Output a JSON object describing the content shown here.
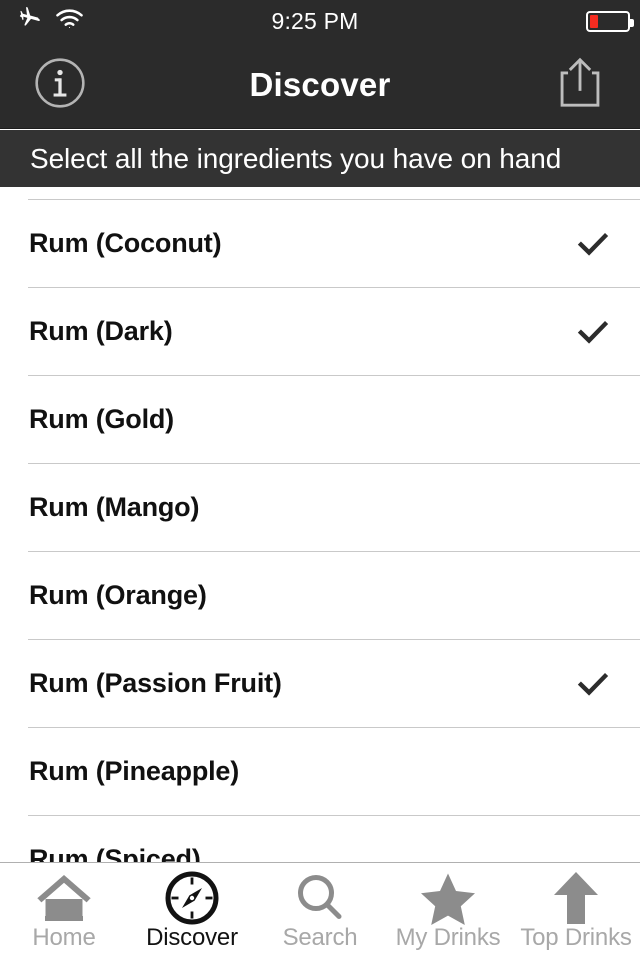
{
  "status_bar": {
    "airplane_icon": "airplane-icon",
    "wifi_icon": "wifi-icon",
    "time": "9:25 PM",
    "battery_icon": "battery-icon",
    "battery_level_percent": 22,
    "battery_color": "#f52c20"
  },
  "nav_bar": {
    "info_icon": "info-circle-icon",
    "title": "Discover",
    "share_icon": "share-icon",
    "background_color": "#2b2b2b"
  },
  "subtitle_bar": {
    "text": "Select all the ingredients you have on hand",
    "background_color": "#333333"
  },
  "list": {
    "check_icon": "checkmark-icon",
    "rows": [
      {
        "label": "Rum (Coconut)",
        "selected": true
      },
      {
        "label": "Rum (Dark)",
        "selected": true
      },
      {
        "label": "Rum (Gold)",
        "selected": false
      },
      {
        "label": "Rum (Mango)",
        "selected": false
      },
      {
        "label": "Rum (Orange)",
        "selected": false
      },
      {
        "label": "Rum (Passion Fruit)",
        "selected": true
      },
      {
        "label": "Rum (Pineapple)",
        "selected": false
      },
      {
        "label": "Rum (Spiced)",
        "selected": false
      }
    ]
  },
  "tab_bar": {
    "active_index": 1,
    "active_color": "#121212",
    "inactive_color": "#a8a8a8",
    "icon_color": "#8c8c8c",
    "tabs": [
      {
        "label": "Home",
        "icon": "home-icon",
        "active": false
      },
      {
        "label": "Discover",
        "icon": "compass-icon",
        "active": true
      },
      {
        "label": "Search",
        "icon": "search-icon",
        "active": false
      },
      {
        "label": "My Drinks",
        "icon": "star-icon",
        "active": false
      },
      {
        "label": "Top Drinks",
        "icon": "arrow-up-icon",
        "active": false
      }
    ]
  }
}
